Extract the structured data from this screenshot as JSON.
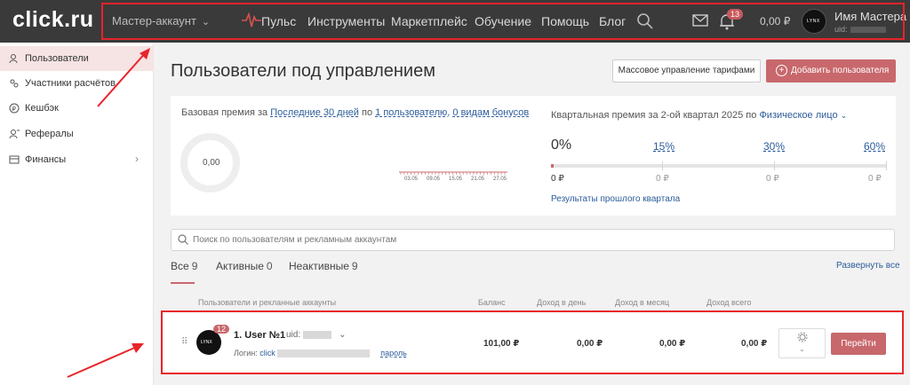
{
  "header": {
    "logo": "click.ru",
    "account_selector": "Мастер-аккаунт",
    "nav": [
      "Пульс",
      "Инструменты",
      "Маркетплейс",
      "Обучение",
      "Помощь",
      "Блог"
    ],
    "notifications_count": "13",
    "balance": "0,00 ₽",
    "user_name": "Имя Мастера",
    "uid_label": "uid:",
    "avatar_text": "LYNX"
  },
  "sidebar": {
    "items": [
      {
        "label": "Пользователи",
        "icon": "users-icon",
        "active": true
      },
      {
        "label": "Участники расчётов",
        "icon": "participants-icon"
      },
      {
        "label": "Кешбэк",
        "icon": "cashback-icon"
      },
      {
        "label": "Рефералы",
        "icon": "referrals-icon"
      },
      {
        "label": "Финансы",
        "icon": "finance-icon"
      }
    ]
  },
  "main": {
    "title": "Пользователи под управлением",
    "btn_mass": "Массовое управление тарифами",
    "btn_add": "Добавить пользователя"
  },
  "bonus": {
    "prefix": "Базовая премия за",
    "period": "Последние 30 дней",
    "by": "по",
    "users": "1 пользователю,",
    "types": "0 видам бонусов",
    "donut_value": "0,00",
    "x_ticks": [
      "03.05",
      "09.05",
      "15.05",
      "21.05",
      "27.05"
    ]
  },
  "quarterly": {
    "title": "Квартальная премия за 2-ой квартал 2025 по",
    "person_type": "Физическое лицо",
    "current_pct": "0%",
    "levels": [
      "15%",
      "30%",
      "60%"
    ],
    "current_rub": "0 ₽",
    "level_rubs": [
      "0 ₽",
      "0 ₽",
      "0 ₽",
      "0 ₽"
    ],
    "results_link": "Результаты прошлого квартала"
  },
  "search": {
    "placeholder": "Поиск по пользователям и рекламным аккаунтам"
  },
  "tabs": [
    {
      "label": "Все",
      "count": "9"
    },
    {
      "label": "Активные",
      "count": "0"
    },
    {
      "label": "Неактивные",
      "count": "9"
    }
  ],
  "expand_all": "Развернуть все",
  "table": {
    "headers": [
      "Пользователи и рекланные аккаунты",
      "Баланс",
      "Доход в день",
      "Доход в месяц",
      "Доход всего"
    ]
  },
  "user_row": {
    "badge": "12",
    "name": "1. User №1",
    "uid_label": "uid:",
    "login_label": "Логин:",
    "login_value": "click",
    "password_link": "пароль",
    "balance": "101,00 ₽",
    "day": "0,00 ₽",
    "month": "0,00 ₽",
    "total": "0,00 ₽",
    "go_button": "Перейти"
  },
  "colors": {
    "accent": "#c8686c",
    "link": "#2b5c9a",
    "topbar": "#3a3a3a",
    "highlight": "#e8242b"
  }
}
